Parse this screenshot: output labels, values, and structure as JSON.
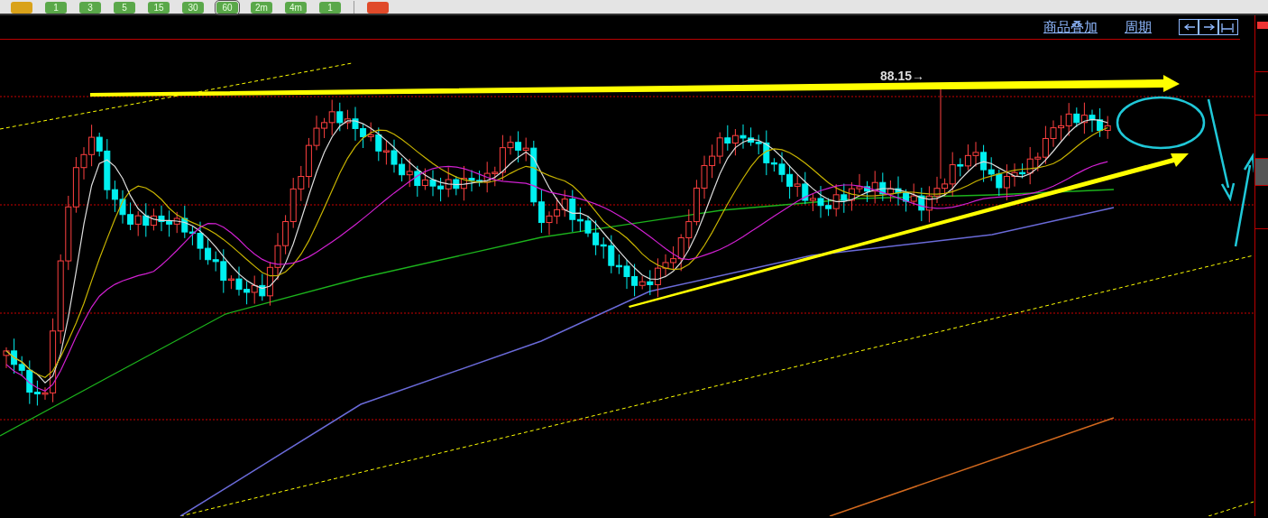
{
  "toolbar": {
    "buttons": [
      {
        "kind": "flag",
        "selected": false
      },
      {
        "kind": "text",
        "label": "1",
        "selected": false
      },
      {
        "kind": "text",
        "label": "3",
        "selected": false
      },
      {
        "kind": "text",
        "label": "5",
        "selected": false
      },
      {
        "kind": "text",
        "label": "15",
        "selected": false
      },
      {
        "kind": "text",
        "label": "30",
        "selected": false
      },
      {
        "kind": "text",
        "label": "60",
        "selected": true
      },
      {
        "kind": "text",
        "label": "2m",
        "selected": false
      },
      {
        "kind": "text",
        "label": "4m",
        "selected": false
      },
      {
        "kind": "text",
        "label": "1",
        "selected": false
      },
      {
        "kind": "window",
        "selected": false
      }
    ]
  },
  "header": {
    "links": [
      "商品叠加",
      "周期"
    ]
  },
  "chart": {
    "price_label": "88.15→"
  },
  "side_tabs": [
    {
      "selected": false
    },
    {
      "selected": false
    },
    {
      "selected": false
    },
    {
      "selected": true
    },
    {
      "selected": false
    }
  ]
}
